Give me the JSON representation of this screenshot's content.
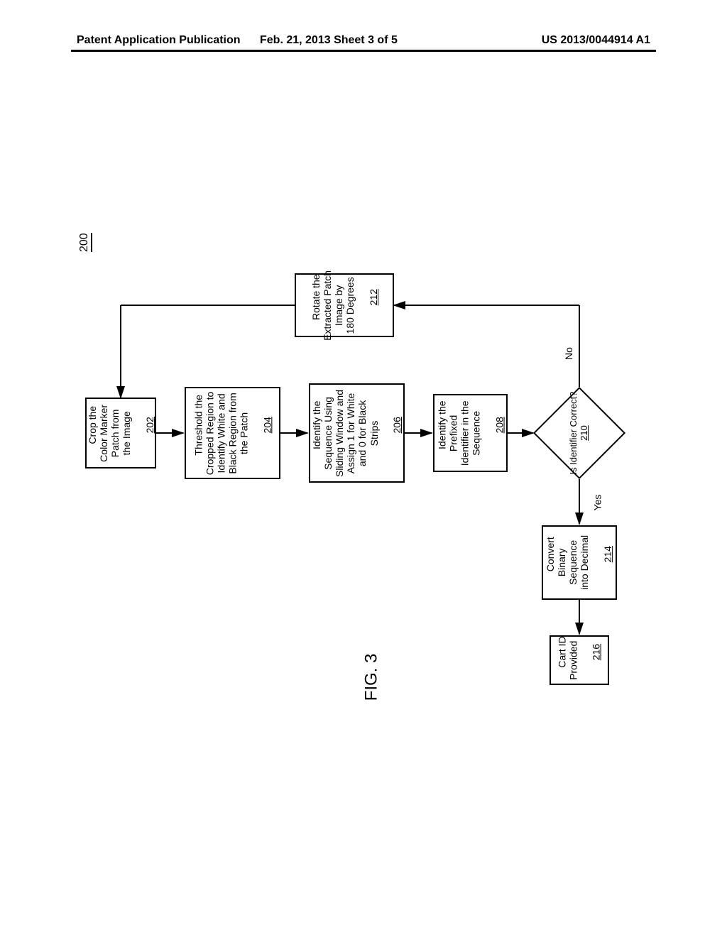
{
  "header": {
    "left": "Patent Application Publication",
    "center": "Feb. 21, 2013  Sheet 3 of 5",
    "right": "US 2013/0044914 A1"
  },
  "figure": {
    "ref_main": "200",
    "title": "FIG. 3"
  },
  "nodes": {
    "n202": {
      "text": "Crop the\nColor Marker\nPatch from\nthe Image",
      "ref": "202"
    },
    "n204": {
      "text": "Threshold the\nCropped Region to\nIdentify White and\nBlack Region from\nthe Patch",
      "ref": "204"
    },
    "n206": {
      "text": "Identify the\nSequence Using\nSliding Window and\nAssign 1 for White\nand 0 for Black Strips",
      "ref": "206"
    },
    "n208": {
      "text": "Identify the\nPrefixed\nIdentifier in the\nSequence",
      "ref": "208"
    },
    "n210": {
      "text": "Is Identifier\nCorrect?",
      "ref": "210"
    },
    "n212": {
      "text": "Rotate the\nExtracted Patch\nImage by\n180 Degrees",
      "ref": "212"
    },
    "n214": {
      "text": "Convert\nBinary\nSequence\ninto Decimal",
      "ref": "214"
    },
    "n216": {
      "text": "Cart ID\nProvided",
      "ref": "216"
    }
  },
  "edges": {
    "no": "No",
    "yes": "Yes"
  }
}
